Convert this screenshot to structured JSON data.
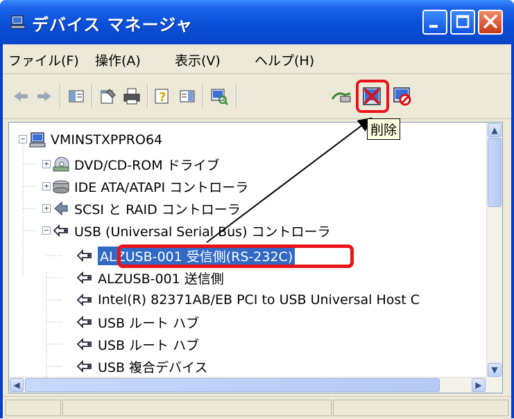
{
  "window": {
    "title": "デバイス マネージャ"
  },
  "menubar": {
    "items": [
      "ファイル(F)",
      "操作(A)",
      "表示(V)",
      "ヘルプ(H)"
    ]
  },
  "toolbar": {
    "icons": [
      "back-icon",
      "forward-icon",
      "view-icon",
      "properties-icon",
      "print-icon",
      "help-icon",
      "view2-icon",
      "scan-icon",
      "update-driver-icon",
      "uninstall-icon",
      "disable-icon"
    ]
  },
  "tooltip": {
    "text": "削除"
  },
  "tree": {
    "root": "VMINSTXPPRO64",
    "categories": [
      {
        "label": "DVD/CD-ROM ドライブ",
        "icon": "dvd-icon",
        "expander": "+"
      },
      {
        "label": "IDE ATA/ATAPI コントローラ",
        "icon": "ide-icon",
        "expander": "+"
      },
      {
        "label": "SCSI と RAID コントローラ",
        "icon": "scsi-icon",
        "expander": "+"
      },
      {
        "label": "USB (Universal Serial Bus) コントローラ",
        "icon": "usb-icon",
        "expander": "−"
      }
    ],
    "usb_devices": [
      {
        "label": "ALZUSB-001 受信側(RS-232C)",
        "selected": true
      },
      {
        "label": "ALZUSB-001 送信側",
        "selected": false
      },
      {
        "label": "Intel(R) 82371AB/EB PCI to USB Universal Host C",
        "selected": false
      },
      {
        "label": "USB ルート ハブ",
        "selected": false
      },
      {
        "label": "USB ルート ハブ",
        "selected": false
      },
      {
        "label": "USB 複合デバイス",
        "selected": false
      }
    ]
  },
  "colors": {
    "titlebar": "#0a4fd8",
    "selection": "#316ac5",
    "annotation": "#e8141a"
  }
}
